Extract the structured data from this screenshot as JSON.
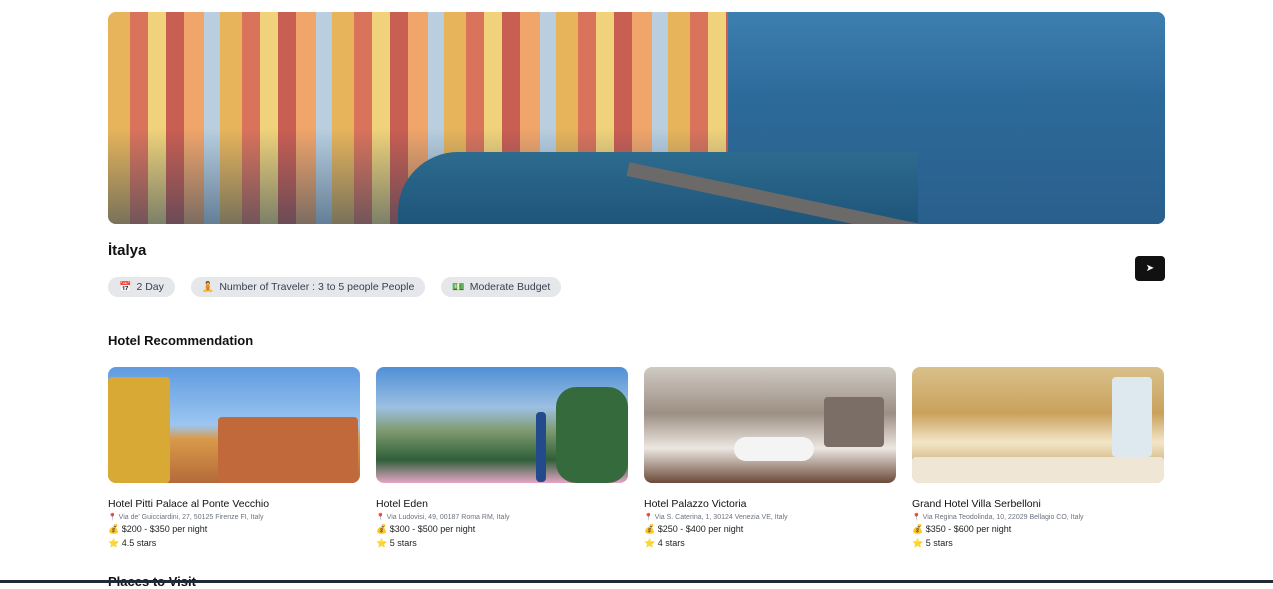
{
  "trip": {
    "destination": "İtalya",
    "chips": [
      {
        "icon": "calendar-icon",
        "glyph": "📅",
        "label": "2 Day"
      },
      {
        "icon": "traveler-icon",
        "glyph": "🧘",
        "label": "Number of Traveler : 3 to 5 people People"
      },
      {
        "icon": "money-icon",
        "glyph": "💵",
        "label": "Moderate Budget"
      }
    ],
    "share_glyph": "➤"
  },
  "hotels_section": {
    "title": "Hotel Recommendation",
    "items": [
      {
        "name": "Hotel Pitti Palace al Ponte Vecchio",
        "address": "Via de' Guicciardini, 27, 50125 Firenze FI, Italy",
        "price": "$200 - $350 per night",
        "rating": "4.5 stars"
      },
      {
        "name": "Hotel Eden",
        "address": "Via Ludovisi, 49, 00187 Roma RM, Italy",
        "price": "$300 - $500 per night",
        "rating": "5 stars"
      },
      {
        "name": "Hotel Palazzo Victoria",
        "address": "Via S. Caterina, 1, 30124 Venezia VE, Italy",
        "price": "$250 - $400 per night",
        "rating": "4 stars"
      },
      {
        "name": "Grand Hotel Villa Serbelloni",
        "address": "Via Regina Teodolinda, 10, 22029 Bellagio CO, Italy",
        "price": "$350 - $600 per night",
        "rating": "5 stars"
      }
    ],
    "glyphs": {
      "pin": "📍",
      "money": "💰",
      "star": "⭐"
    }
  },
  "places_section": {
    "title": "Places to Visit"
  }
}
